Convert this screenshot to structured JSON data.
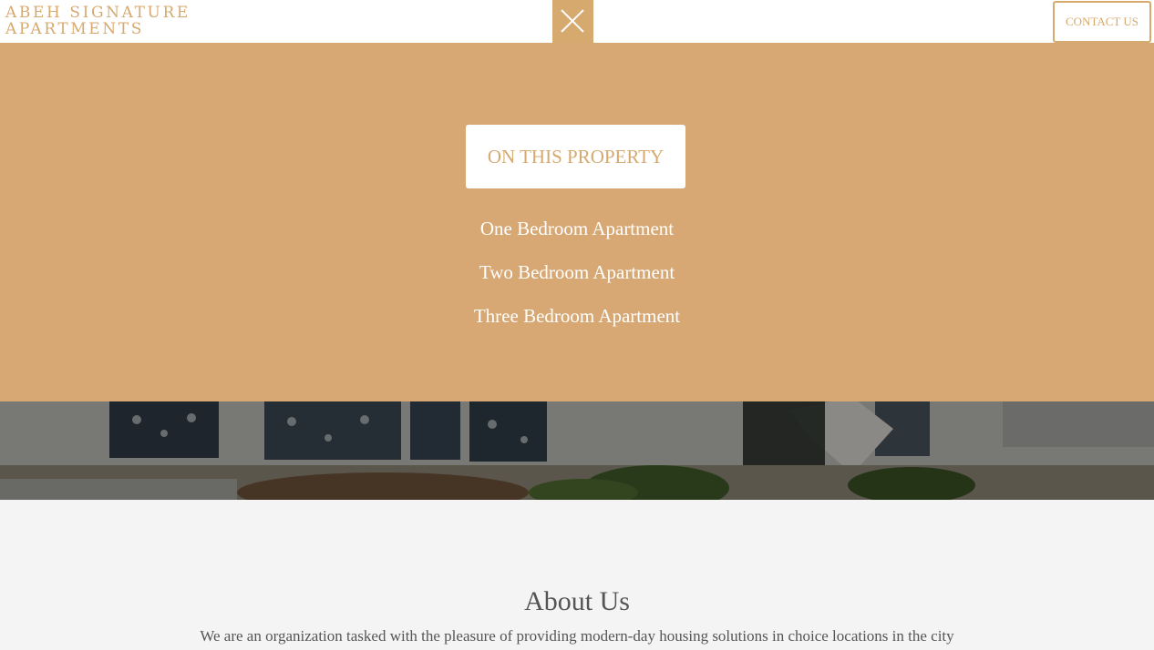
{
  "header": {
    "logo_line1": "ABEH SIGNATURE",
    "logo_line2": "APARTMENTS",
    "close_icon": "close-icon",
    "contact_label": "CONTACT US"
  },
  "menu": {
    "property_label": "ON THIS PROPERTY",
    "items": [
      {
        "label": "One Bedroom Apartment"
      },
      {
        "label": "Two Bedroom Apartment"
      },
      {
        "label": "Three Bedroom Apartment"
      }
    ]
  },
  "about": {
    "title": "About Us",
    "text": "We are an organization tasked with the pleasure of providing modern-day housing solutions in choice locations in the city"
  },
  "colors": {
    "accent": "#d6a96f",
    "menu_background": "#d7a873",
    "text_gray": "#555555",
    "section_background": "#f4f4f4"
  }
}
